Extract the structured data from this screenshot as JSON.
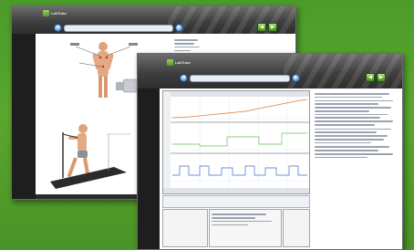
{
  "back_window": {
    "title": "LabTutor",
    "url": "",
    "ctrl_label": "",
    "button_prev_symbol": "◄",
    "button_next_symbol": "►",
    "green_btn1_symbol": "◀",
    "green_btn2_symbol": "▶"
  },
  "front_window": {
    "title": "LabTutor",
    "url": "",
    "ctrl_label": "",
    "button_prev_symbol": "◄",
    "button_next_symbol": "►",
    "green_btn1_symbol": "◀",
    "green_btn2_symbol": "▶",
    "side_section_heads": [
      "",
      "",
      ""
    ]
  },
  "colors": {
    "background_green": "#4f9c2b",
    "titlebar_dark": "#3a3a3a",
    "trace_orange": "#e07a3a",
    "trace_green": "#6fbf5a",
    "trace_blue": "#3d6fc2",
    "link_blue": "#2d5fa0"
  },
  "icons": [
    "labtutor-logo-icon",
    "back-icon",
    "forward-icon",
    "previous-page-icon",
    "next-page-icon"
  ]
}
